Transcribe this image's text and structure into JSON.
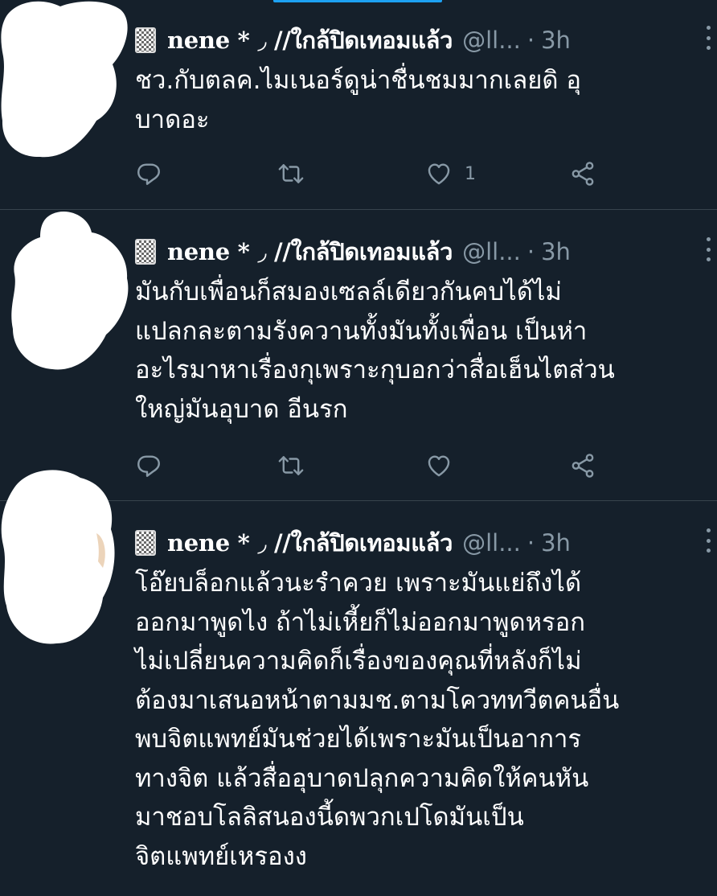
{
  "colors": {
    "background": "#15202b",
    "text": "#ffffff",
    "secondary": "#8899a6",
    "divider": "#38444d",
    "accent": "#1da1f2"
  },
  "tweets": [
    {
      "display_name": "nene * ◞ //ใกล้ปิดเทอมแล้ว",
      "handle": "@ll...",
      "separator": "·",
      "time": "3h",
      "lines": [
        "ชว.กับตลค.ไมเนอร์ดูน่าชื่นชมมากเลยดิ อุ",
        "บาดอะ"
      ],
      "like_count": "1",
      "icons": [
        "reply-icon",
        "retweet-icon",
        "like-icon",
        "share-icon",
        "more-icon"
      ]
    },
    {
      "display_name": "nene * ◞ //ใกล้ปิดเทอมแล้ว",
      "handle": "@ll...",
      "separator": "·",
      "time": "3h",
      "lines": [
        "มันกับเพื่อนก็สมองเซลล์เดียวกันคบได้ไม่",
        "แปลกละตามรังควานทั้งมันทั้งเพื่อน เป็นห่า",
        "อะไรมาหาเรื่องกุเพราะกุบอกว่าสื่อเฮ็นไตส่วน",
        "ใหญ่มันอุบาด อีนรก"
      ],
      "like_count": "",
      "icons": [
        "reply-icon",
        "retweet-icon",
        "like-icon",
        "share-icon",
        "more-icon"
      ]
    },
    {
      "display_name": "nene * ◞ //ใกล้ปิดเทอมแล้ว",
      "handle": "@ll...",
      "separator": "·",
      "time": "3h",
      "lines": [
        "โอ๊ยบล็อกแล้วนะรำควย เพราะมันแย่ถึงได้",
        "ออกมาพูดไง ถ้าไม่เหี้ยก็ไม่ออกมาพูดหรอก",
        "ไม่เปลี่ยนความคิดก็เรื่องของคุณที่หลังก็ไม่",
        "ต้องมาเสนอหน้าตามมช.ตามโควททวีตคนอื่น",
        "พบจิตแพทย์มันช่วยได้เพราะมันเป็นอาการ",
        "ทางจิต แล้วสื่ออุบาดปลุกความคิดให้คนหัน",
        "มาชอบโลลิสนองนี้ดพวกเปโดมันเป็น",
        "จิตแพทย์เหรองง"
      ],
      "icons": [
        "more-icon"
      ]
    }
  ]
}
